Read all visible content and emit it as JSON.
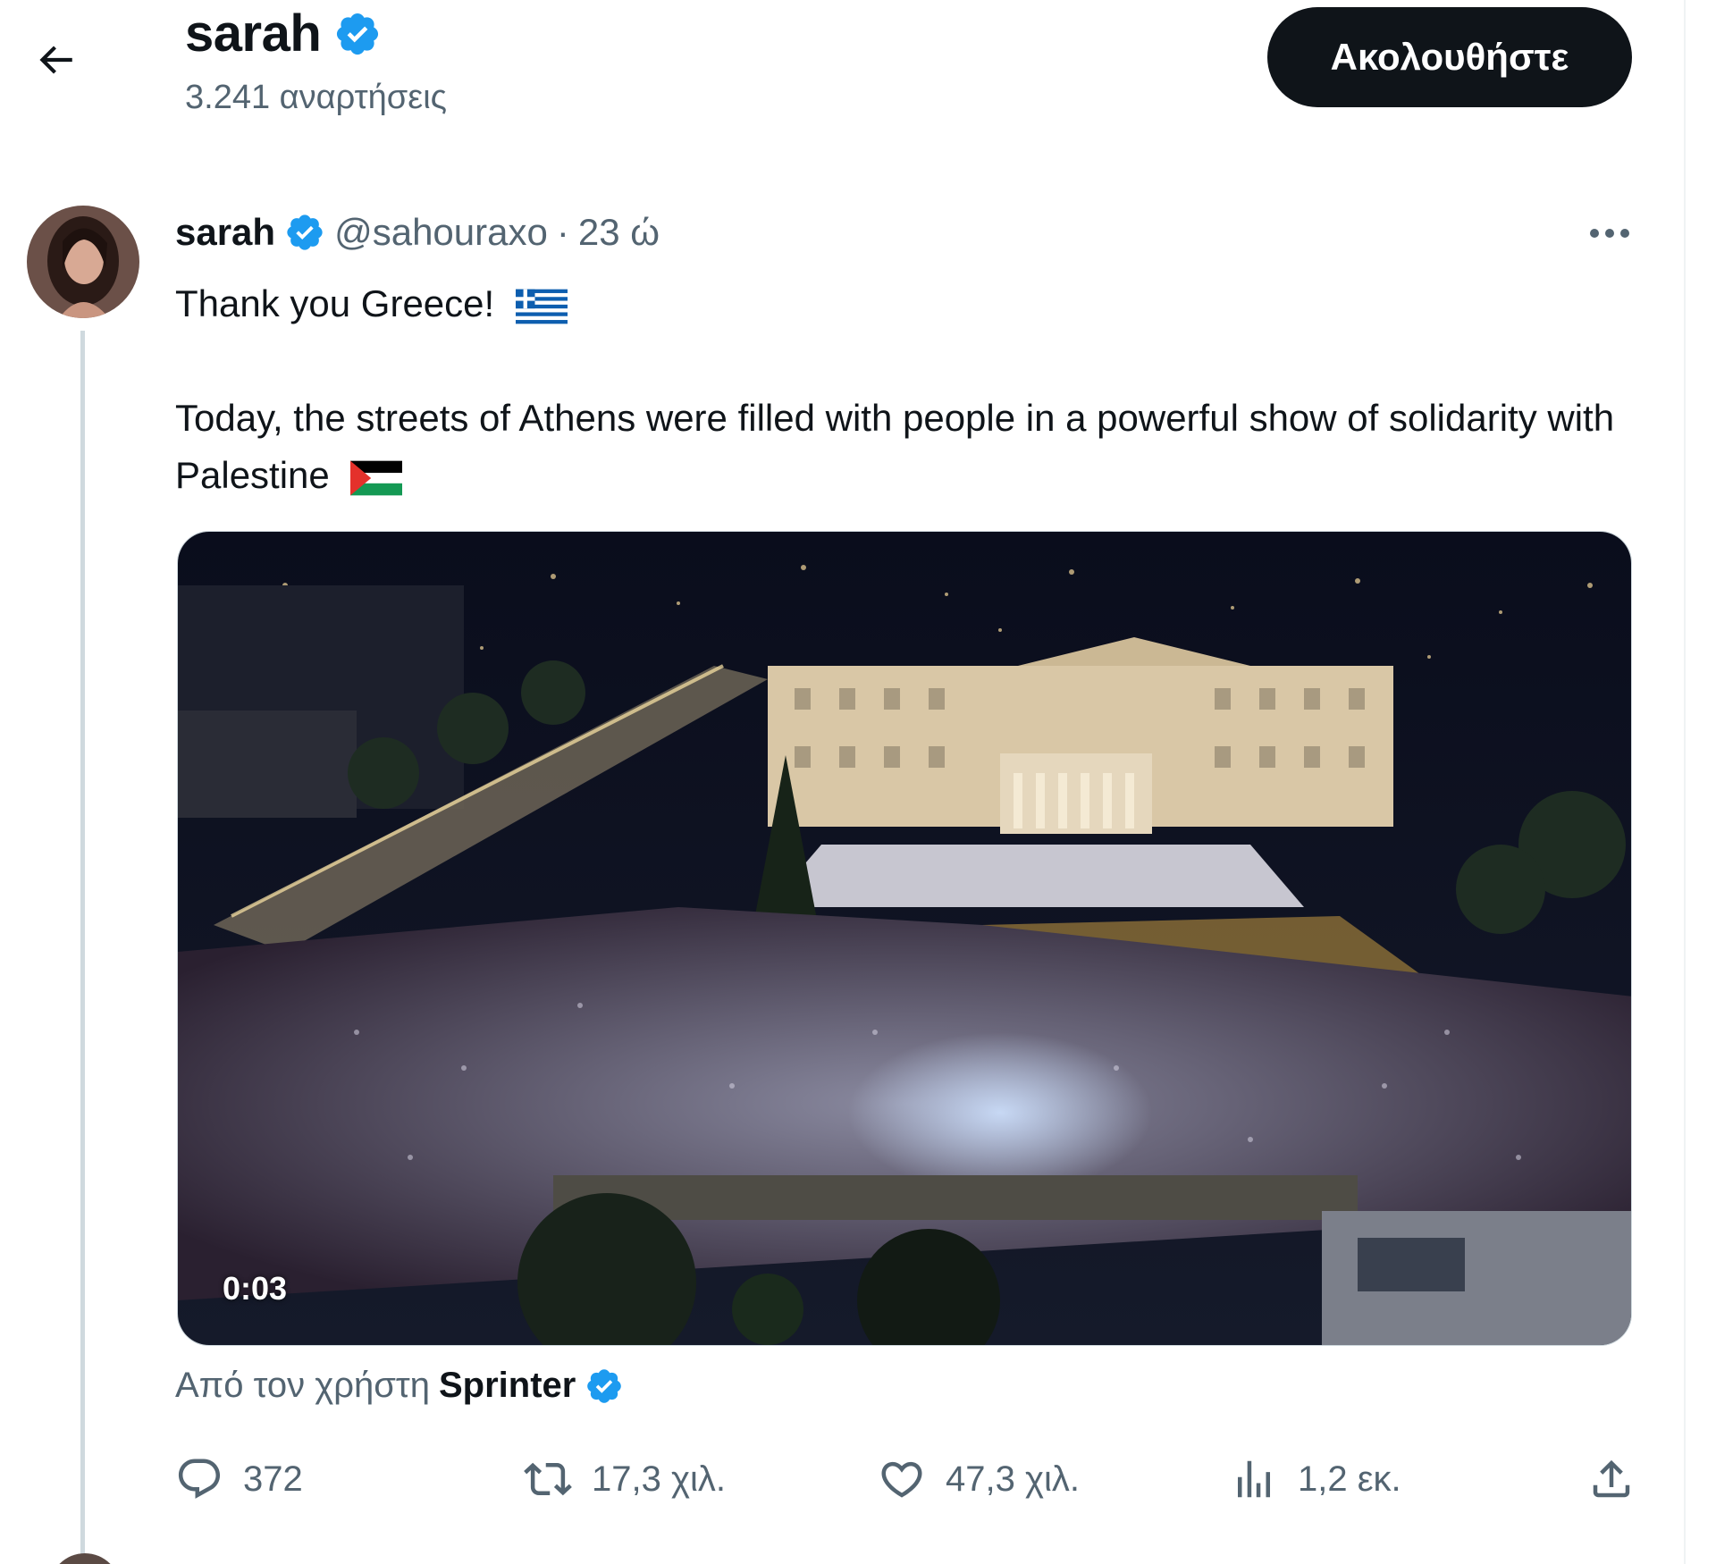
{
  "header": {
    "back_icon": "arrow-left-icon",
    "name": "sarah",
    "verified_icon": "verified-badge-icon",
    "post_count": "3.241 αναρτήσεις",
    "follow_label": "Ακολουθήστε"
  },
  "tweet": {
    "author_name": "sarah",
    "handle": "@sahouraxo",
    "separator": "·",
    "time": "23 ώ",
    "more_icon": "more-dots-icon",
    "text_line1": "Thank you Greece!",
    "text_line2": "Today, the streets of Athens were filled with people in a powerful show of solidarity with Palestine",
    "flag_greece": "greece-flag-emoji",
    "flag_palestine": "palestine-flag-emoji",
    "media": {
      "type": "video",
      "description_icon": "video-thumbnail",
      "duration": "0:03"
    },
    "attribution": {
      "prefix": "Από τον χρήστη",
      "user": "Sprinter"
    },
    "actions": {
      "reply": {
        "icon": "reply-icon",
        "count": "372"
      },
      "retweet": {
        "icon": "retweet-icon",
        "count": "17,3 χιλ."
      },
      "like": {
        "icon": "heart-icon",
        "count": "47,3 χιλ."
      },
      "views": {
        "icon": "views-chart-icon",
        "count": "1,2 εκ."
      },
      "share": {
        "icon": "share-upload-icon"
      }
    }
  },
  "colors": {
    "text_primary": "#0f1419",
    "text_secondary": "#536471",
    "verified_blue": "#1d9bf0",
    "follow_button_bg": "#0f1419",
    "border": "#cfd9de"
  }
}
